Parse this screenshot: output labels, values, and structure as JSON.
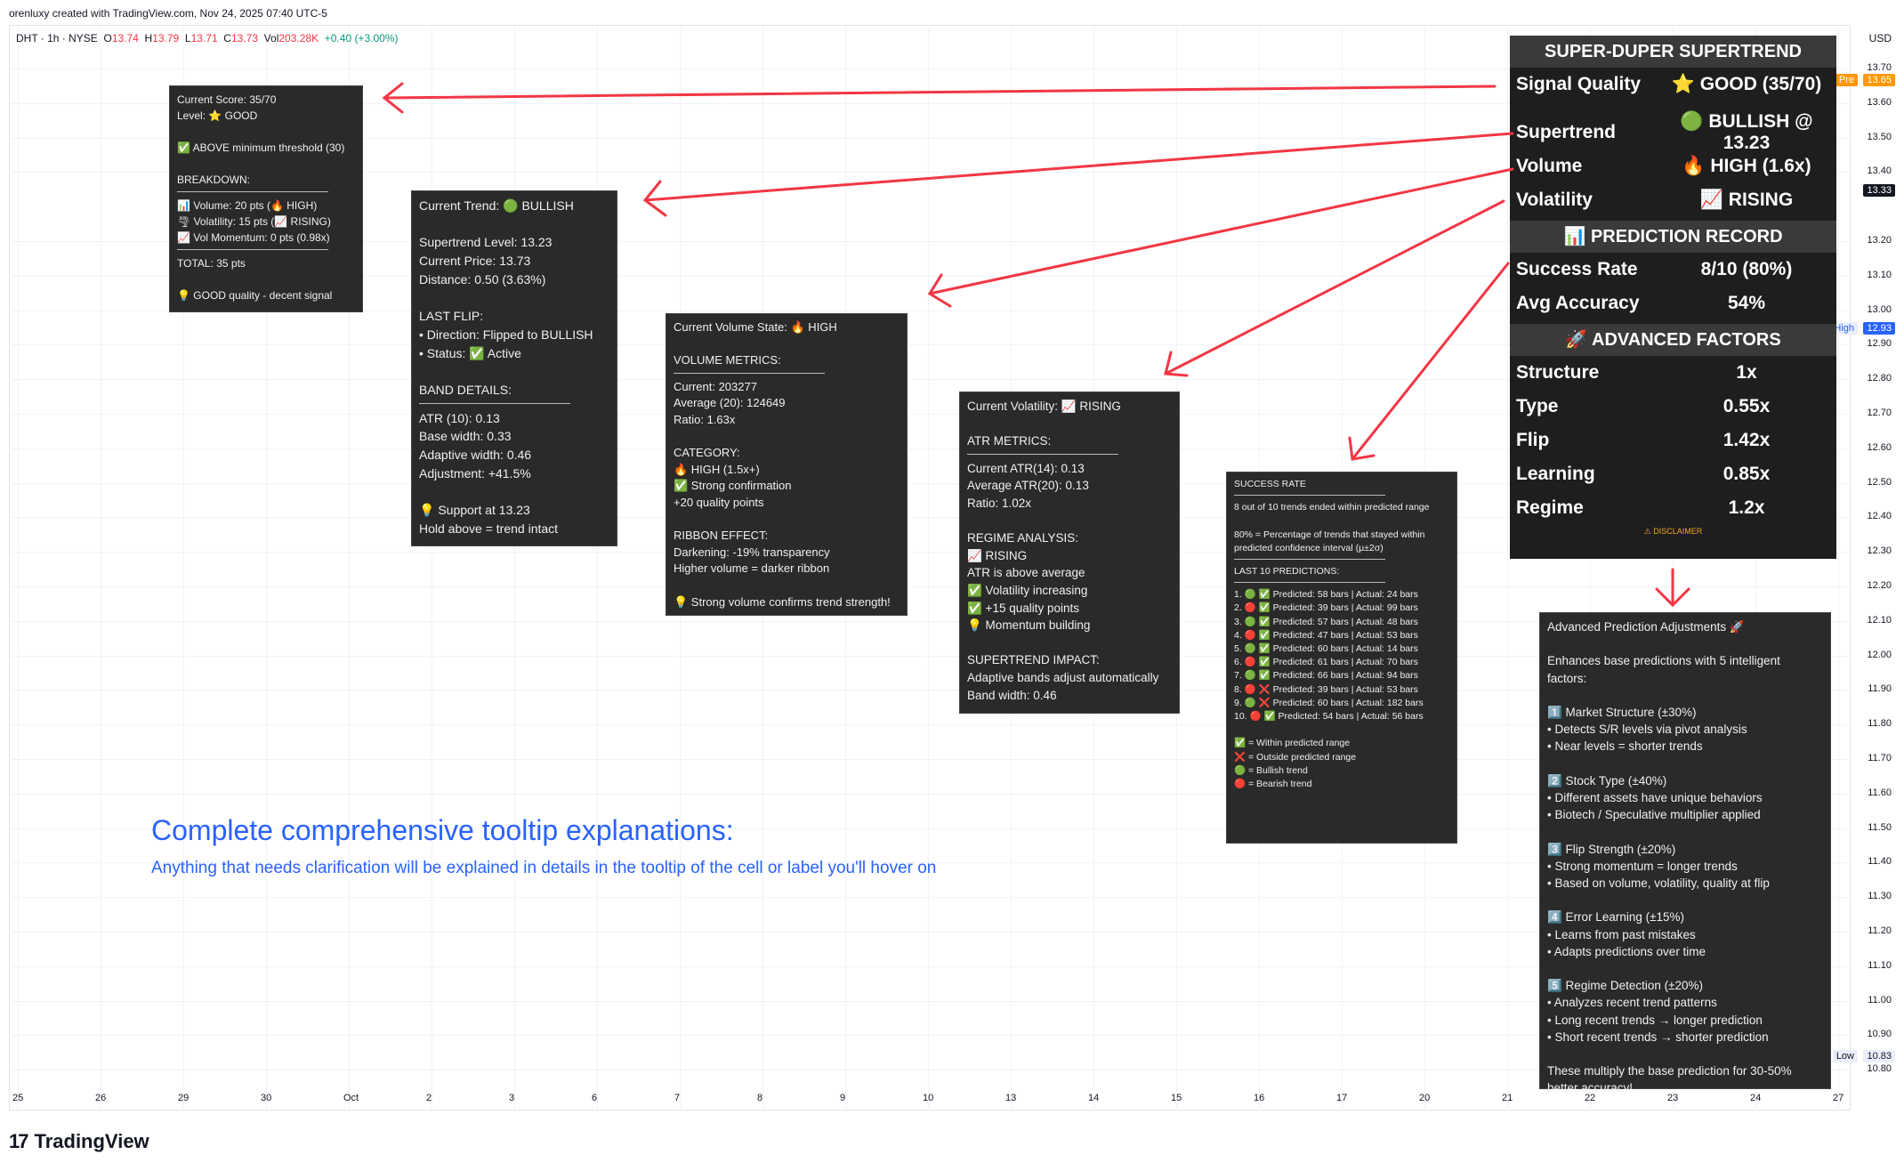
{
  "header": {
    "credit": "orenluxy created with TradingView.com, Nov 24, 2025 07:40 UTC-5",
    "symbol": "DHT · 1h · NYSE",
    "o_label": "O",
    "o": "13.74",
    "h_label": "H",
    "h": "13.79",
    "l_label": "L",
    "l": "13.71",
    "c_label": "C",
    "c": "13.73",
    "vol_label": "Vol",
    "vol": "203.28K",
    "change": "+0.40 (+3.00%)"
  },
  "price_axis": {
    "currency": "USD",
    "labels": [
      "13.70",
      "13.60",
      "13.50",
      "13.40",
      "13.20",
      "13.10",
      "13.00",
      "12.90",
      "12.80",
      "12.70",
      "12.60",
      "12.50",
      "12.40",
      "12.30",
      "12.20",
      "12.10",
      "12.00",
      "11.90",
      "11.80",
      "11.70",
      "11.60",
      "11.50",
      "11.40",
      "11.30",
      "11.20",
      "11.10",
      "11.00",
      "10.90",
      "10.80"
    ],
    "tag_pre_label": "Pre",
    "tag_pre_value": "13.65",
    "tag_current": "13.33",
    "tag_high_label": "High",
    "tag_high_value": "12.93",
    "tag_low_label": "Low",
    "tag_low_value": "10.83",
    "colors": {
      "pre": "#ff9800",
      "current": "#131722",
      "high": "#2962ff"
    }
  },
  "time_axis": [
    "25",
    "26",
    "29",
    "30",
    "Oct",
    "2",
    "3",
    "6",
    "7",
    "8",
    "9",
    "10",
    "13",
    "14",
    "15",
    "16",
    "17",
    "20",
    "21",
    "22",
    "23",
    "24",
    "27"
  ],
  "main_panel": {
    "title": "SUPER-DUPER SUPERTREND",
    "rows1": [
      {
        "k": "Signal Quality",
        "v": "⭐ GOOD (35/70)"
      },
      {
        "k": "",
        "v": ""
      },
      {
        "k": "Supertrend",
        "v": "🟢 BULLISH @ 13.23"
      },
      {
        "k": "Volume",
        "v": "🔥 HIGH (1.6x)"
      },
      {
        "k": "Volatility",
        "v": "📈 RISING"
      }
    ],
    "pred_title": "📊 PREDICTION RECORD",
    "rows2": [
      {
        "k": "Success Rate",
        "v": "8/10 (80%)"
      },
      {
        "k": "Avg Accuracy",
        "v": "54%"
      }
    ],
    "adv_title": "🚀 ADVANCED FACTORS",
    "rows3": [
      {
        "k": "Structure",
        "v": "1x"
      },
      {
        "k": "Type",
        "v": "0.55x"
      },
      {
        "k": "Flip",
        "v": "1.42x"
      },
      {
        "k": "Learning",
        "v": "0.85x"
      },
      {
        "k": "Regime",
        "v": "1.2x"
      }
    ],
    "disclaimer": "⚠ DISCLAIMER"
  },
  "tooltips": {
    "score": [
      "Current Score: 35/70",
      "Level: ⭐ GOOD",
      "",
      "✅ ABOVE minimum threshold (30)",
      "",
      "BREAKDOWN:",
      "---",
      "📊 Volume: 20 pts (🔥 HIGH)",
      "🌪 Volatility: 15 pts (📈 RISING)",
      "📈 Vol Momentum: 0 pts (0.98x)",
      "---",
      "TOTAL: 35 pts",
      "",
      "💡 GOOD quality - decent signal"
    ],
    "trend": [
      "Current Trend: 🟢 BULLISH",
      "",
      "Supertrend Level: 13.23",
      "Current Price: 13.73",
      "Distance: 0.50 (3.63%)",
      "",
      "LAST FLIP:",
      "• Direction: Flipped to BULLISH",
      "• Status: ✅ Active",
      "",
      "BAND DETAILS:",
      "---",
      "ATR (10): 0.13",
      "Base width: 0.33",
      "Adaptive width: 0.46",
      "Adjustment: +41.5%",
      "",
      "💡 Support at 13.23",
      "   Hold above = trend intact"
    ],
    "volume": [
      "Current Volume State: 🔥 HIGH",
      "",
      "VOLUME METRICS:",
      "---",
      "Current: 203277",
      "Average (20): 124649",
      "Ratio: 1.63x",
      "",
      "CATEGORY:",
      "🔥 HIGH (1.5x+)",
      "   ✅ Strong confirmation",
      "   +20 quality points",
      "",
      "RIBBON EFFECT:",
      "Darkening: -19% transparency",
      "Higher volume = darker ribbon",
      "",
      "💡 Strong volume confirms trend strength!"
    ],
    "volatility": [
      "Current Volatility: 📈 RISING",
      "",
      "ATR METRICS:",
      "---",
      "Current ATR(14): 0.13",
      "Average ATR(20): 0.13",
      "Ratio: 1.02x",
      "",
      "REGIME ANALYSIS:",
      "📈 RISING",
      "   ATR is above average",
      "   ✅ Volatility increasing",
      "   ✅ +15 quality points",
      "   💡 Momentum building",
      "",
      "SUPERTREND IMPACT:",
      "Adaptive bands adjust automatically",
      "Band width: 0.46"
    ],
    "success": [
      "SUCCESS RATE",
      "---",
      "8 out of 10 trends ended within predicted range",
      "",
      "80% = Percentage of trends that stayed within",
      "predicted confidence interval (μ±2σ)",
      "---",
      "LAST 10 PREDICTIONS:",
      "---",
      "1.  🟢 ✅ Predicted: 58 bars | Actual: 24 bars",
      "2.  🔴 ✅ Predicted: 39 bars | Actual: 99 bars",
      "3.  🟢 ✅ Predicted: 57 bars | Actual: 48 bars",
      "4.  🔴 ✅ Predicted: 47 bars | Actual: 53 bars",
      "5.  🟢 ✅ Predicted: 60 bars | Actual: 14 bars",
      "6.  🔴 ✅ Predicted: 61 bars | Actual: 70 bars",
      "7.  🟢 ✅ Predicted: 66 bars | Actual: 94 bars",
      "8.  🔴 ❌ Predicted: 39 bars | Actual: 53 bars",
      "9.  🟢 ❌ Predicted: 60 bars | Actual: 182 bars",
      "10. 🔴 ✅ Predicted: 54 bars | Actual: 56 bars",
      "",
      "✅ = Within predicted range",
      "❌ = Outside predicted range",
      "🟢 = Bullish trend",
      "🔴 = Bearish trend"
    ],
    "advanced": [
      "Advanced Prediction Adjustments 🚀",
      "",
      "Enhances base predictions with 5 intelligent",
      "factors:",
      "",
      "1️⃣ Market Structure (±30%)",
      "• Detects S/R levels via pivot analysis",
      "• Near levels = shorter trends",
      "",
      "2️⃣ Stock Type (±40%)",
      "• Different assets have unique behaviors",
      "• Biotech / Speculative multiplier applied",
      "",
      "3️⃣ Flip Strength (±20%)",
      "• Strong momentum = longer trends",
      "• Based on volume, volatility, quality at flip",
      "",
      "4️⃣ Error Learning (±15%)",
      "• Learns from past mistakes",
      "• Adapts predictions over time",
      "",
      "5️⃣ Regime Detection (±20%)",
      "• Analyzes recent trend patterns",
      "• Long recent trends → longer prediction",
      "• Short recent trends → shorter prediction",
      "",
      "These multiply the base prediction for 30-50%",
      "better accuracy!"
    ]
  },
  "caption": {
    "title": "Complete comprehensive tooltip explanations:",
    "subtitle": "Anything that needs clarification will be explained in details in the tooltip of the cell or label you'll hover on"
  },
  "logo_text": "TradingView",
  "colors": {
    "arrow": "#f23645",
    "caption": "#2962ff",
    "panel_bg": "#1e1e1e",
    "tooltip_bg": "#2a2a2a"
  }
}
